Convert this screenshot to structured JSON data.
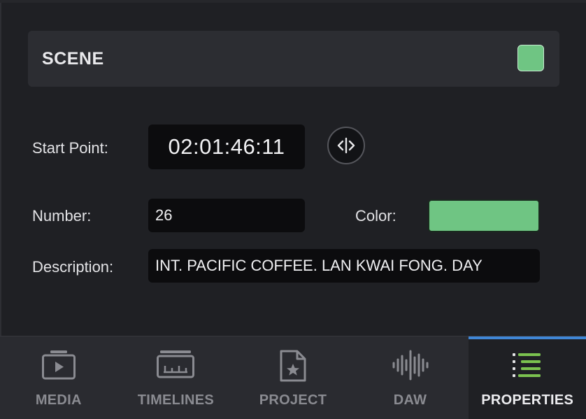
{
  "colors": {
    "scene_color": "#6fc583",
    "active_tab_indicator": "#3f86d6",
    "properties_icon_accent": "#7bc24f"
  },
  "scene": {
    "title": "SCENE"
  },
  "fields": {
    "start_point_label": "Start Point:",
    "start_point_value": "02:01:46:11",
    "number_label": "Number:",
    "number_value": "26",
    "color_label": "Color:",
    "description_label": "Description:",
    "description_value": "INT. PACIFIC COFFEE. LAN KWAI FONG. DAY"
  },
  "tabs": [
    {
      "label": "MEDIA",
      "icon": "media-icon",
      "active": false
    },
    {
      "label": "TIMELINES",
      "icon": "timelines-icon",
      "active": false
    },
    {
      "label": "PROJECT",
      "icon": "project-icon",
      "active": false
    },
    {
      "label": "DAW",
      "icon": "waveform-icon",
      "active": false
    },
    {
      "label": "PROPERTIES",
      "icon": "properties-icon",
      "active": true
    }
  ]
}
